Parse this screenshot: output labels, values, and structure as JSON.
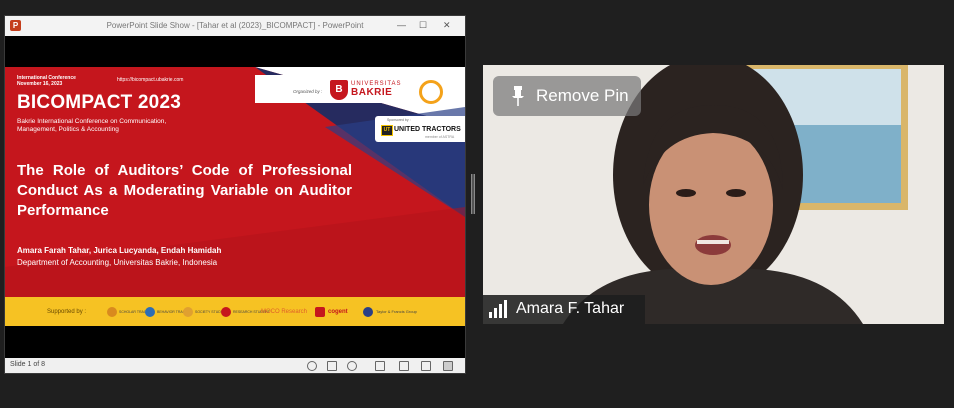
{
  "powerpoint": {
    "window_title": "PowerPoint Slide Show - [Tahar et al (2023)_BICOMPACT] - PowerPoint",
    "status_slide": "Slide 1 of 8"
  },
  "slide": {
    "conference_label_line1": "International Conference",
    "conference_label_line2": "November 16, 2023",
    "url": "https://bicompact.ubakrie.com",
    "title": "BICOMPACT 2023",
    "subtitle": "Bakrie International Conference on Communication, Management, Politics & Accounting",
    "organized_by": "Organized by :",
    "university_line1": "UNIVERSITAS",
    "university_line2": "BAKRIE",
    "sponsored_by": "Sponsored by :",
    "sponsor_name": "UNITED TRACTORS",
    "sponsor_sub": "member of ASTRA",
    "paper_title": "The Role of Auditors’ Code of Professional Conduct As a Moderating Variable on Auditor Performance",
    "authors": "Amara Farah Tahar, Jurica Lucyanda, Endah Hamidah",
    "department": "Department of Accounting, Universitas Bakrie, Indonesia",
    "supported_by": "Supported by :",
    "supporter_logos": [
      "SCHOLAR TRACE",
      "BEHAVIOR TRACK",
      "SOCIETY STUDY",
      "RESEARCH STUDENT",
      "MOCO Research",
      "cogent",
      "Taylor & Francis Group"
    ]
  },
  "video": {
    "remove_pin_label": "Remove Pin",
    "participant_name": "Amara F. Tahar"
  },
  "colors": {
    "slide_red": "#c5161d",
    "slide_navy": "#1d2c63",
    "supporter_yellow": "#f6c223",
    "meeting_bg": "#1f1f1f"
  }
}
